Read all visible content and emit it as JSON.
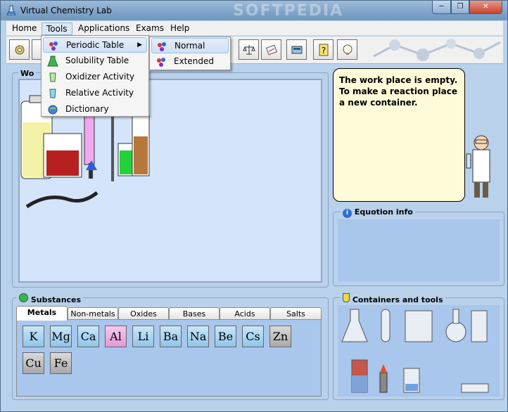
{
  "window": {
    "title": "Virtual Chemistry Lab",
    "watermark": "SOFTPEDIA"
  },
  "menubar": {
    "items": [
      "Home",
      "Tools",
      "Applications",
      "Exams",
      "Help"
    ]
  },
  "tools_menu": {
    "items": [
      "Periodic Table",
      "Solubility Table",
      "Oxidizer Activity",
      "Relative Activity",
      "Dictionary"
    ]
  },
  "periodic_submenu": {
    "items": [
      "Normal",
      "Extended"
    ]
  },
  "workarea": {
    "title": "Wo"
  },
  "assistant": {
    "message": "The work place is empty. To make a reaction place a new container."
  },
  "equation": {
    "title": "Equotion info"
  },
  "substances": {
    "title": "Substances",
    "tabs": [
      "Metals",
      "Non-metals",
      "Oxides",
      "Bases",
      "Acids",
      "Salts"
    ],
    "active_tab": "Metals",
    "elements": [
      {
        "symbol": "K",
        "style": "alk"
      },
      {
        "symbol": "Mg",
        "style": "alk"
      },
      {
        "symbol": "Ca",
        "style": "alk"
      },
      {
        "symbol": "Al",
        "style": "al"
      },
      {
        "symbol": "Li",
        "style": "alk"
      },
      {
        "symbol": "Ba",
        "style": "alk"
      },
      {
        "symbol": "Na",
        "style": "alk"
      },
      {
        "symbol": "Be",
        "style": "alk"
      },
      {
        "symbol": "Cs",
        "style": "alk"
      },
      {
        "symbol": "Zn",
        "style": "grey"
      },
      {
        "symbol": "Cu",
        "style": "grey"
      },
      {
        "symbol": "Fe",
        "style": "grey"
      }
    ]
  },
  "containers": {
    "title": "Containers and tools"
  },
  "colors": {
    "panel": "#b9d1ea",
    "workspace": "#d4e4fa",
    "bubble": "#fffbd8",
    "accent": "#8fc5ea"
  }
}
